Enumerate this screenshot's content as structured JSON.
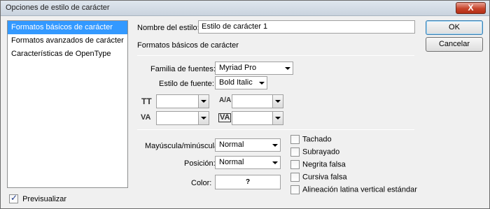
{
  "window": {
    "title": "Opciones de estilo de carácter",
    "close_label": "X"
  },
  "left_list": {
    "items": [
      {
        "label": "Formatos básicos de carácter",
        "selected": true
      },
      {
        "label": "Formatos avanzados de carácter",
        "selected": false
      },
      {
        "label": "Características de OpenType",
        "selected": false
      }
    ]
  },
  "preview": {
    "label": "Previsualizar",
    "checked": true
  },
  "style_name": {
    "label": "Nombre del estilo:",
    "value": "Estilo de carácter 1"
  },
  "section": {
    "title": "Formatos básicos de carácter"
  },
  "font": {
    "family_label": "Familia de fuentes:",
    "family_value": "Myriad Pro",
    "style_label": "Estilo de fuente:",
    "style_value": "Bold Italic"
  },
  "metrics": {
    "size_icon": "TT",
    "leading_icon": "A/A",
    "kerning_icon": "VA",
    "tracking_icon": "VA",
    "size_value": "",
    "leading_value": "",
    "kerning_value": "",
    "tracking_value": ""
  },
  "formatting": {
    "case_label": "Mayúscula/minúscula:",
    "case_value": "Normal",
    "position_label": "Posición:",
    "position_value": "Normal",
    "color_label": "Color:",
    "color_value": "?"
  },
  "checkboxes": [
    {
      "label": "Tachado",
      "checked": false
    },
    {
      "label": "Subrayado",
      "checked": false
    },
    {
      "label": "Negrita falsa",
      "checked": false
    },
    {
      "label": "Cursiva falsa",
      "checked": false
    },
    {
      "label": "Alineación latina vertical estándar",
      "checked": false
    }
  ],
  "buttons": {
    "ok": "OK",
    "cancel": "Cancelar"
  }
}
